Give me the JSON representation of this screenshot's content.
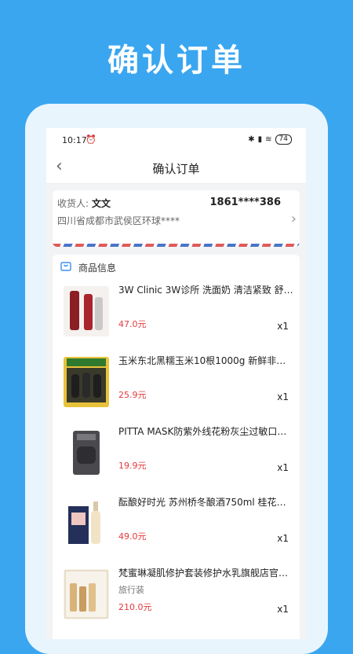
{
  "hero_title": "确认订单",
  "status": {
    "time": "10:17",
    "battery": "74"
  },
  "nav": {
    "title": "确认订单"
  },
  "address": {
    "consignee_label": "收货人:",
    "consignee_name": "文文",
    "phone": "1861****386",
    "detail": "四川省成都市武侯区环球****"
  },
  "goods": {
    "header": "商品信息",
    "items": [
      {
        "name": "3W Clinic 3W诊所 洗面奶 清洁紧致 舒缓…",
        "spec": "",
        "price": "47.0元",
        "qty": "x1"
      },
      {
        "name": "玉米东北黑糯玉米10根1000g 新鲜非转…",
        "spec": "",
        "price": "25.9元",
        "qty": "x1"
      },
      {
        "name": "PITTA MASK防紫外线花粉灰尘过敏口罩…",
        "spec": "",
        "price": "19.9元",
        "qty": "x1"
      },
      {
        "name": "酝酿好时光 苏州桥冬酿酒750ml 桂花酒…",
        "spec": "",
        "price": "49.0元",
        "qty": "x1"
      },
      {
        "name": "梵蜜琳凝肌修护套装修护水乳旗舰店官…",
        "spec": "旅行装",
        "price": "210.0元",
        "qty": "x1"
      }
    ]
  },
  "colors": {
    "accent": "#3aa6f0",
    "price": "#e4393c"
  }
}
